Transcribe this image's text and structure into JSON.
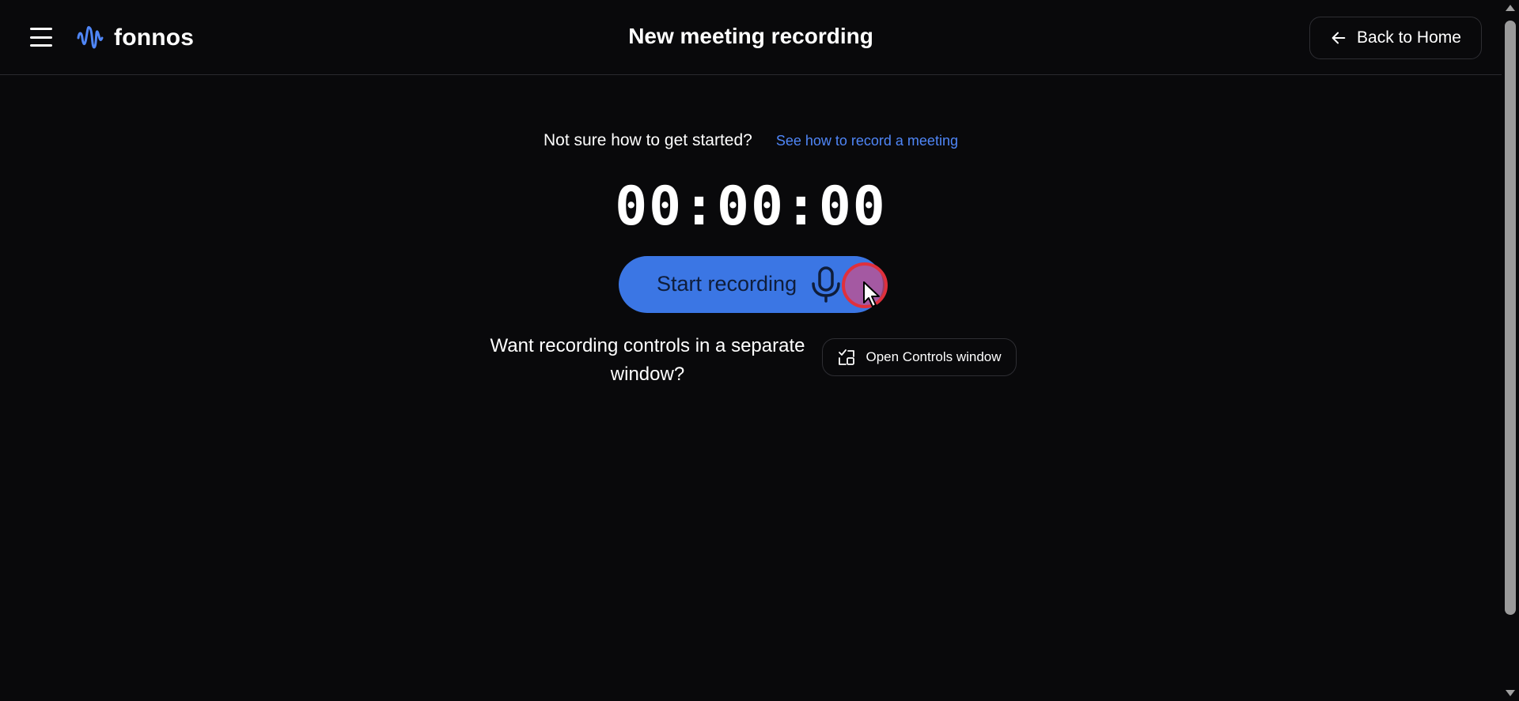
{
  "header": {
    "brand": "fonnos",
    "title": "New meeting recording",
    "back_label": "Back to Home"
  },
  "help": {
    "text": "Not sure how to get started?",
    "link": "See how to record a meeting"
  },
  "timer": "00:00:00",
  "record": {
    "label": "Start recording"
  },
  "controls": {
    "text": "Want recording controls in a separate window?",
    "button_label": "Open Controls window"
  },
  "colors": {
    "background": "#09090b",
    "accent": "#3b76e4",
    "link": "#4f86f7"
  },
  "icons": [
    "menu-icon",
    "fonnos-logo-icon",
    "arrow-left-icon",
    "microphone-icon",
    "external-window-icon",
    "cursor-icon"
  ]
}
